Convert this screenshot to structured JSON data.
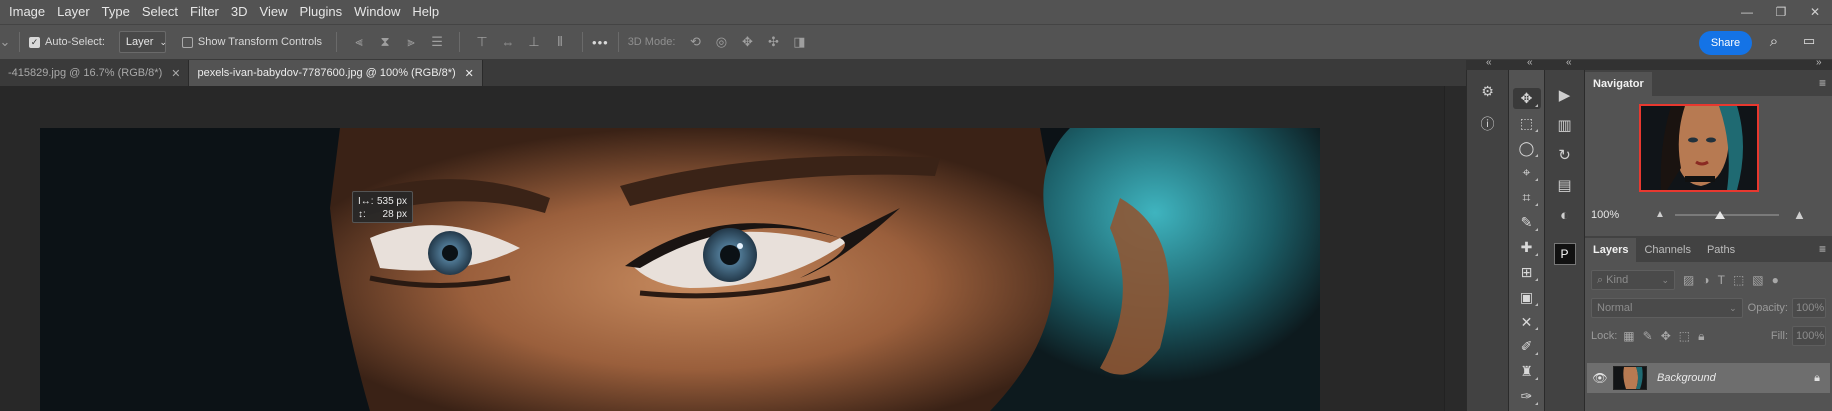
{
  "menu": [
    "Image",
    "Layer",
    "Type",
    "Select",
    "Filter",
    "3D",
    "View",
    "Plugins",
    "Window",
    "Help"
  ],
  "window_controls": [
    "minimize-icon",
    "restore-icon",
    "close-icon"
  ],
  "options_bar": {
    "auto_select_label": "Auto-Select:",
    "auto_select_checked": true,
    "auto_select_target": "Layer",
    "show_transform_label": "Show Transform Controls",
    "show_transform_checked": false,
    "three_d_mode_label": "3D Mode:",
    "more_label": "•••",
    "share_label": "Share"
  },
  "tabs": [
    {
      "label": "-415829.jpg @ 16.7% (RGB/8*)",
      "active": false
    },
    {
      "label": "pexels-ivan-babydov-7787600.jpg @ 100% (RGB/8*)",
      "active": true
    }
  ],
  "measure_tooltip": {
    "width_icon": "I↔:",
    "width_value": "535 px",
    "height_icon": "↕:",
    "height_value": "28 px"
  },
  "navigator": {
    "tab_label": "Navigator",
    "zoom": "100%",
    "zoom_slider_fraction": 0.43
  },
  "layers_panel": {
    "tabs": [
      "Layers",
      "Channels",
      "Paths"
    ],
    "active_tab": "Layers",
    "filter_placeholder": "Kind",
    "blend_mode": "Normal",
    "opacity_label": "Opacity:",
    "opacity_value": "100%",
    "lock_label": "Lock:",
    "fill_label": "Fill:",
    "fill_value": "100%",
    "layers": [
      {
        "name": "Background",
        "visible": true,
        "locked": true
      }
    ]
  },
  "colors": {
    "accent": "#1473e6",
    "navigator_frame": "#e8382f",
    "app_bg": "#535353",
    "canvas_bg": "#282828"
  }
}
